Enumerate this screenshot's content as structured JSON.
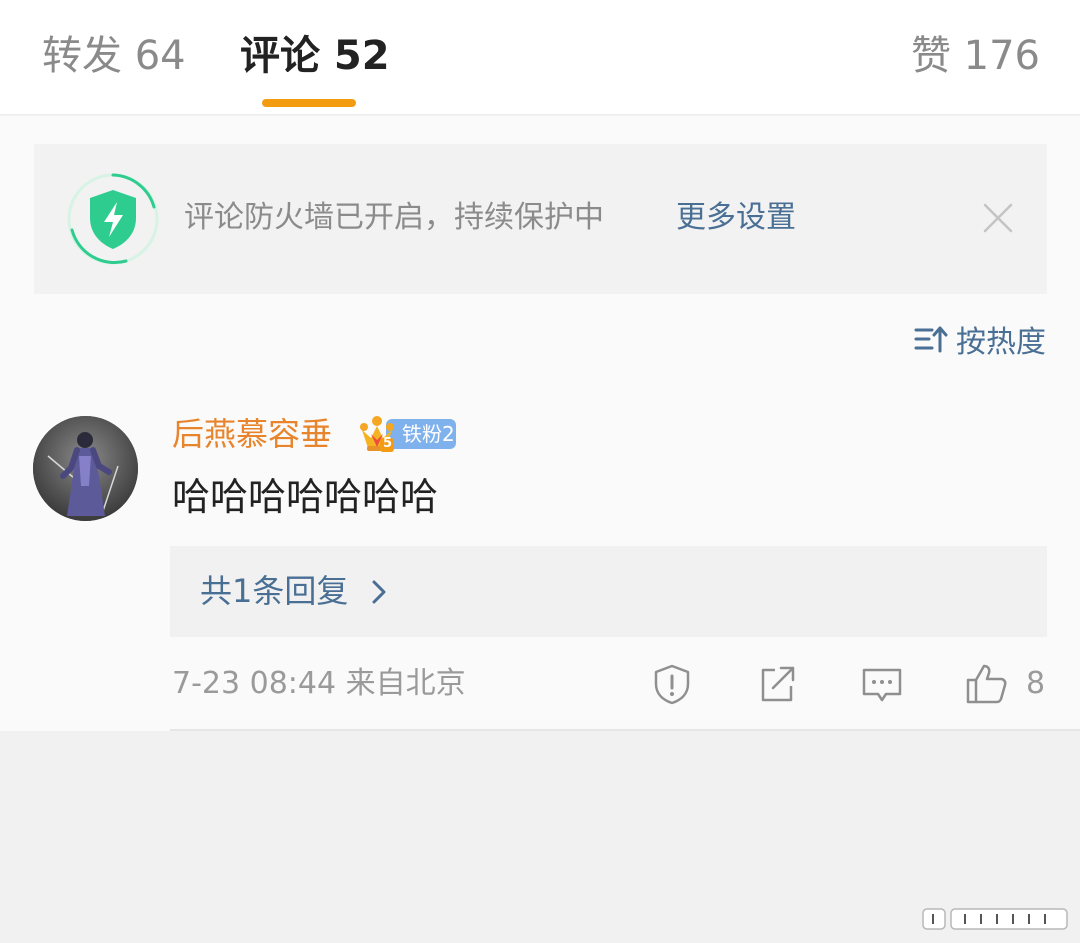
{
  "tabs": {
    "repost": "转发 64",
    "comments": "评论 52",
    "likes": "赞 176"
  },
  "firewall": {
    "message": "评论防火墙已开启，持续保护中",
    "link": "更多设置"
  },
  "sort": {
    "label": "按热度"
  },
  "comment": {
    "username": "后燕慕容垂",
    "badge": "铁粉2",
    "badge_level": "5",
    "text": "哈哈哈哈哈哈哈",
    "reply_summary": "共1条回复",
    "time_location": "7-23 08:44  来自北京",
    "likes": "8"
  },
  "colors": {
    "accent": "#f39c12",
    "link": "#4a6f95",
    "username": "#e8842b",
    "shield": "#2ecc8f",
    "badge": "#7fb2ec"
  },
  "icons": {
    "shield": "shield-bolt-icon",
    "close": "close-icon",
    "sort": "sort-icon",
    "chevron": "chevron-right-icon",
    "report": "report-icon",
    "share": "share-icon",
    "comment": "comment-icon",
    "like": "thumbs-up-icon"
  }
}
